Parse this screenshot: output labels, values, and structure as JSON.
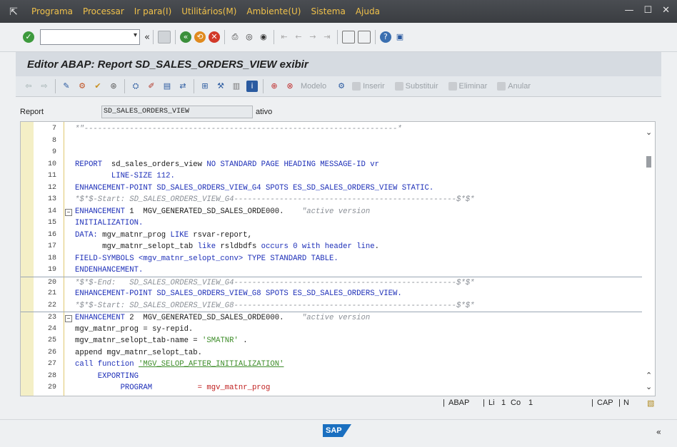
{
  "menu": {
    "items": [
      "Programa",
      "Processar",
      "Ir para(I)",
      "Utilitários(M)",
      "Ambiente(U)",
      "Sistema",
      "Ajuda"
    ],
    "window_buttons": [
      "—",
      "☐",
      "✕"
    ]
  },
  "toolbar": {
    "command_value": "",
    "collapse_glyph": "«"
  },
  "title": "Editor ABAP: Report SD_SALES_ORDERS_VIEW exibir",
  "app_toolbar": {
    "text_buttons": [
      "Modelo",
      "Inserir",
      "Substituir",
      "Eliminar",
      "Anular"
    ]
  },
  "report": {
    "label": "Report",
    "value": "SD_SALES_ORDERS_VIEW",
    "status": "ativo"
  },
  "code_lines": [
    {
      "n": "7",
      "t": "*\"---------------------------------------------------------------------*",
      "cls": "cm",
      "fold": ""
    },
    {
      "n": "8",
      "t": "",
      "cls": "",
      "fold": ""
    },
    {
      "n": "9",
      "t": "",
      "cls": "",
      "fold": ""
    },
    {
      "n": "10",
      "t": "REPORT  sd_sales_orders_view NO STANDARD PAGE HEADING MESSAGE-ID vr",
      "cls": "report",
      "fold": ""
    },
    {
      "n": "11",
      "t": "        LINE-SIZE 112.",
      "cls": "kw",
      "fold": ""
    },
    {
      "n": "12",
      "t": "ENHANCEMENT-POINT SD_SALES_ORDERS_VIEW_G4 SPOTS ES_SD_SALES_ORDERS_VIEW STATIC.",
      "cls": "kw",
      "fold": ""
    },
    {
      "n": "13",
      "t": "*$*$-Start: SD_SALES_ORDERS_VIEW_G4-------------------------------------------------$*$*",
      "cls": "cm",
      "fold": ""
    },
    {
      "n": "14",
      "t": "ENHANCEMENT 1  MGV_GENERATED_SD_SALES_ORDE000.    \"active version",
      "cls": "enh",
      "fold": "⊟"
    },
    {
      "n": "15",
      "t": "INITIALIZATION.",
      "cls": "kw",
      "fold": ""
    },
    {
      "n": "16",
      "t": "DATA: mgv_matnr_prog LIKE rsvar-report,",
      "cls": "data",
      "fold": ""
    },
    {
      "n": "17",
      "t": "      mgv_matnr_selopt_tab like rsldbdfs occurs 0 with header line.",
      "cls": "data2",
      "fold": ""
    },
    {
      "n": "18",
      "t": "FIELD-SYMBOLS <mgv_matnr_selopt_conv> TYPE STANDARD TABLE.",
      "cls": "kw",
      "fold": ""
    },
    {
      "n": "19",
      "t": "ENDENHANCEMENT.",
      "cls": "kw",
      "fold": ""
    },
    {
      "n": "20",
      "t": "*$*$-End:   SD_SALES_ORDERS_VIEW_G4-------------------------------------------------$*$*",
      "cls": "cm",
      "fold": ""
    },
    {
      "n": "21",
      "t": "ENHANCEMENT-POINT SD_SALES_ORDERS_VIEW_G8 SPOTS ES_SD_SALES_ORDERS_VIEW.",
      "cls": "kw",
      "fold": ""
    },
    {
      "n": "22",
      "t": "*$*$-Start: SD_SALES_ORDERS_VIEW_G8-------------------------------------------------$*$*",
      "cls": "cm",
      "fold": ""
    },
    {
      "n": "23",
      "t": "ENHANCEMENT 2  MGV_GENERATED_SD_SALES_ORDE000.    \"active version",
      "cls": "enh",
      "fold": "⊟"
    },
    {
      "n": "24",
      "t": "mgv_matnr_prog = sy-repid.",
      "cls": "plain",
      "fold": ""
    },
    {
      "n": "25",
      "t": "mgv_matnr_selopt_tab-name = 'SMATNR' .",
      "cls": "strline",
      "fold": ""
    },
    {
      "n": "26",
      "t": "append mgv_matnr_selopt_tab.",
      "cls": "plain",
      "fold": ""
    },
    {
      "n": "27",
      "t": "call function 'MGV_SELOP_AFTER_INITIALIZATION'",
      "cls": "call",
      "fold": ""
    },
    {
      "n": "28",
      "t": "     EXPORTING",
      "cls": "kw",
      "fold": ""
    },
    {
      "n": "29",
      "t": "          PROGRAM          = mgv_matnr_prog",
      "cls": "prog",
      "fold": ""
    }
  ],
  "editor_status": {
    "lang": "ABAP",
    "line_label": "Li",
    "line_value": "1",
    "col_label": "Co",
    "col_value": "1",
    "caps": "CAP",
    "num": "N"
  },
  "bottom": {
    "logo_text": "SAP",
    "expand_glyph": "«"
  },
  "colors": {
    "keyword": "#1d2fb8",
    "comment": "#8a8f96",
    "string": "#3e8d2a",
    "menu_text": "#f0c14a",
    "title_bg": "#d6dbe1"
  }
}
